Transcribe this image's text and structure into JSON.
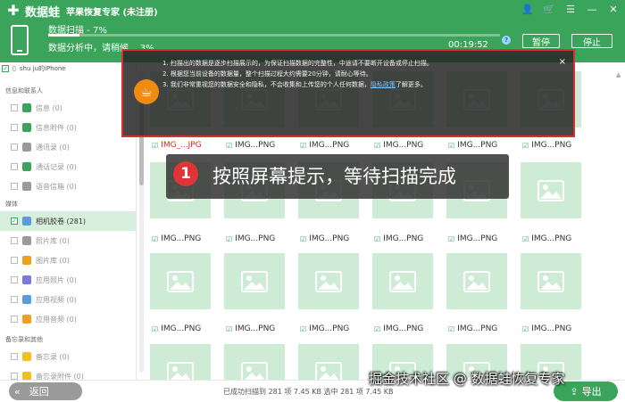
{
  "app": {
    "logo_text": "数据蛙",
    "title": "苹果恢复专家 (未注册)",
    "window_icons": [
      "user-icon",
      "cart-icon",
      "menu-icon",
      "minimize-icon",
      "close-icon"
    ]
  },
  "scan": {
    "title": "数据扫描 - 7%",
    "progress_percent": 7,
    "status": "数据分析中，请稍候... 3%",
    "elapsed": "00:19:52",
    "info_mark": "?",
    "pause_label": "暂停",
    "stop_label": "停止"
  },
  "sidebar": {
    "device": "shu ju的iPhone",
    "sections": [
      {
        "title": "信息和联系人",
        "items": [
          {
            "label": "信息 (0)",
            "icon_color": "#3aa55a"
          },
          {
            "label": "信息附件 (0)",
            "icon_color": "#3aa55a"
          },
          {
            "label": "通讯录 (0)",
            "icon_color": "#9a9a9a"
          },
          {
            "label": "通话记录 (0)",
            "icon_color": "#3aa55a"
          },
          {
            "label": "语音信箱 (0)",
            "icon_color": "#9a9a9a"
          }
        ]
      },
      {
        "title": "媒体",
        "items": [
          {
            "label": "相机胶卷 (281)",
            "icon_color": "#5a9be0",
            "active": true
          },
          {
            "label": "照片库 (0)",
            "icon_color": "#9a9a9a"
          },
          {
            "label": "图片库 (0)",
            "icon_color": "#f0a020"
          },
          {
            "label": "应用照片 (0)",
            "icon_color": "#7a7ae0"
          },
          {
            "label": "应用视频 (0)",
            "icon_color": "#5a9be0"
          },
          {
            "label": "应用音频 (0)",
            "icon_color": "#f0a020"
          }
        ]
      },
      {
        "title": "备忘录和其他",
        "items": [
          {
            "label": "备忘录 (0)",
            "icon_color": "#f0c020"
          },
          {
            "label": "备忘录附件 (0)",
            "icon_color": "#f0c020"
          }
        ]
      }
    ]
  },
  "grid": {
    "rows": [
      {
        "captions": [
          "IMG_...JPG",
          "IMG...PNG",
          "IMG...PNG",
          "IMG...PNG",
          "IMG...PNG",
          "IMG...PNG"
        ],
        "red_first": true
      },
      {
        "captions": [
          "IMG...PNG",
          "IMG...PNG",
          "IMG...PNG",
          "IMG...PNG",
          "IMG...PNG",
          "IMG...PNG"
        ]
      },
      {
        "captions": [
          "IMG...PNG",
          "IMG...PNG",
          "IMG...PNG",
          "IMG...PNG",
          "IMG...PNG",
          "IMG...PNG"
        ]
      }
    ]
  },
  "notice": {
    "line1": "1. 扫描出的数据是逐步扫描展示的，为保证扫描数据的完整性，中途请不要断开设备或停止扫描。",
    "line2": "2. 根据您当前设备的数据量，整个扫描过程大约需要20分钟，请耐心等待。",
    "line3_prefix": "3. 我们非常重视您的数据安全和隐私，不会收集和上传您的个人任何数据，",
    "link": "隐私政策",
    "line3_suffix": "了解更多。",
    "close": "×"
  },
  "callout": {
    "number": "1",
    "text": "按照屏幕提示，等待扫描完成"
  },
  "bottom": {
    "back_label": "返回",
    "footer": "已成功扫描到 281 项 7.45 KB  选中 281 项 7.45 KB",
    "export_label": "导出",
    "watermark": "掘金技术社区 @ 数据蛙恢复专家"
  }
}
